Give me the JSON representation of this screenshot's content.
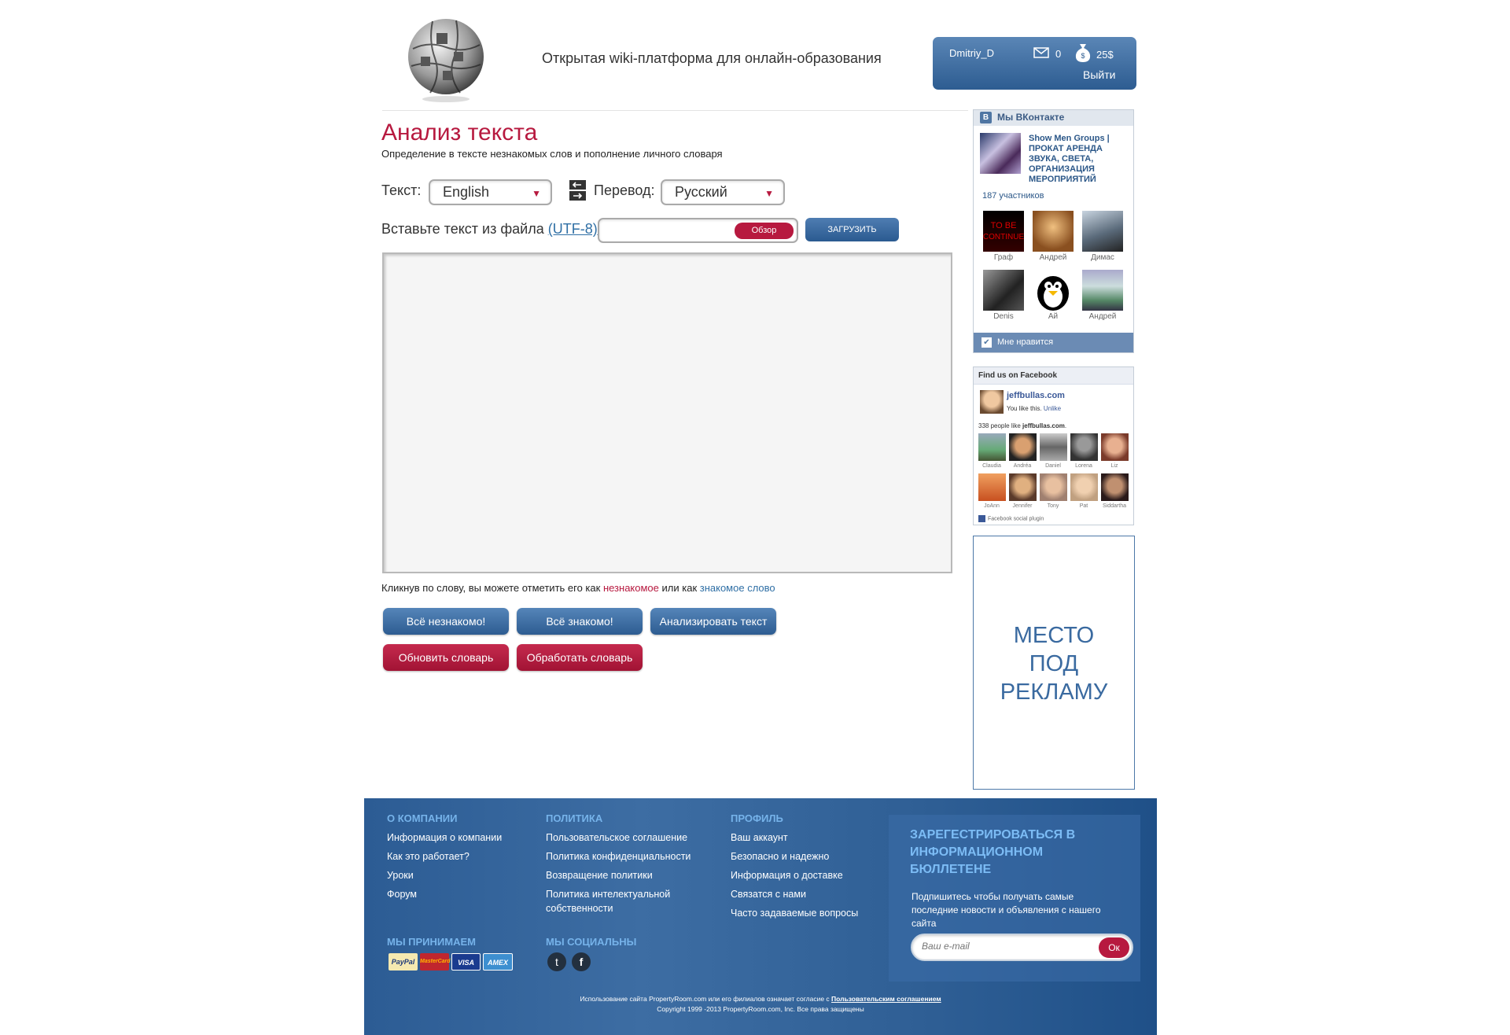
{
  "header": {
    "tagline": "Открытая wiki-платформа для онлайн-образования",
    "user": {
      "name": "Dmitriy_D",
      "messages": "0",
      "balance": "25$",
      "logout": "Выйти"
    }
  },
  "main": {
    "title": "Анализ текста",
    "subtitle": "Определение в тексте незнакомых слов и пополнение личного словаря",
    "text_label": "Текст:",
    "text_language": "English",
    "translation_label": "Перевод:",
    "translation_language": "Русский",
    "file_label_prefix": "Вставьте текст из файла ",
    "file_label_link": "(UTF-8)",
    "file_label_suffix": ":",
    "browse_button": "Обзор",
    "upload_button": "ЗАГРУЗИТЬ",
    "hint_prefix": "Кликнув по слову, вы можете отметить его как ",
    "hint_unknown": "незнакомое",
    "hint_middle": " или как ",
    "hint_known": "знакомое слово",
    "buttons": {
      "all_unknown": "Всё незнакомо!",
      "all_known": "Всё знакомо!",
      "analyze": "Анализировать текст",
      "update_dict": "Обновить словарь",
      "process_dict": "Обработать словарь"
    }
  },
  "vk_widget": {
    "header": "Мы ВКонтакте",
    "group_name": "Show Men Groups | ПРОКАТ АРЕНДА ЗВУКА, СВЕТА, ОРГАНИЗАЦИЯ МЕРОПРИЯТИЙ",
    "members": "187 участников",
    "avatars": [
      "Граф",
      "Андрей",
      "Димас",
      "Denis",
      "Ай",
      "Андрей"
    ],
    "like": "Мне нравится"
  },
  "fb_widget": {
    "header": "Find us on Facebook",
    "page": "jeffbullas.com",
    "you_like": "You like this.",
    "unlike": "Unlike",
    "people_prefix": "338 people like ",
    "people_page": "jeffbullas.com",
    "people_suffix": ".",
    "friends": [
      "Claudia",
      "Andréa",
      "Daniel",
      "Lorena",
      "Liz",
      "JoAnn",
      "Jennifer",
      "Tony",
      "Pat",
      "Siddartha"
    ],
    "footer": "Facebook social plugin"
  },
  "ad": {
    "line1": "МЕСТО",
    "line2": "ПОД",
    "line3": "РЕКЛАМУ"
  },
  "footer": {
    "company": {
      "title": "О КОМПАНИИ",
      "links": [
        "Информация о компании",
        "Как это работает?",
        "Уроки",
        "Форум"
      ]
    },
    "policy": {
      "title": "ПОЛИТИКА",
      "links": [
        "Пользовательское соглашение",
        "Политика конфиденциальности",
        "Возвращение политики",
        "Политика интелектуальной",
        "собственности"
      ]
    },
    "profile": {
      "title": "ПРОФИЛЬ",
      "links": [
        "Ваш аккаунт",
        "Безопасно и надежно",
        "Информация о доставке",
        "Связатся с нами",
        "Часто задаваемые вопросы"
      ]
    },
    "accept": {
      "title": "МЫ ПРИНИМАЕМ",
      "cards": [
        "PayPal",
        "MasterCard",
        "VISA",
        "AMEX"
      ]
    },
    "social": {
      "title": "МЫ СОЦИАЛЬНЫ"
    },
    "newsletter": {
      "title": "ЗАРЕГЕСТРИРОВАТЬСЯ В ИНФОРМАЦИОННОМ БЮЛЛЕТЕНЕ",
      "text": "Подпишитесь чтобы получать самые последние новости и объявления с нашего сайта",
      "placeholder": "Ваш e-mail",
      "ok": "Ок"
    },
    "legal_prefix": "Использование сайта PropertyRoom.com или его филиалов означает согласие с ",
    "legal_link": "Пользовательским соглашением",
    "copyright": "Copyright 1999 -2013 PropertyRoom.com, Inc. Все права защищены"
  }
}
